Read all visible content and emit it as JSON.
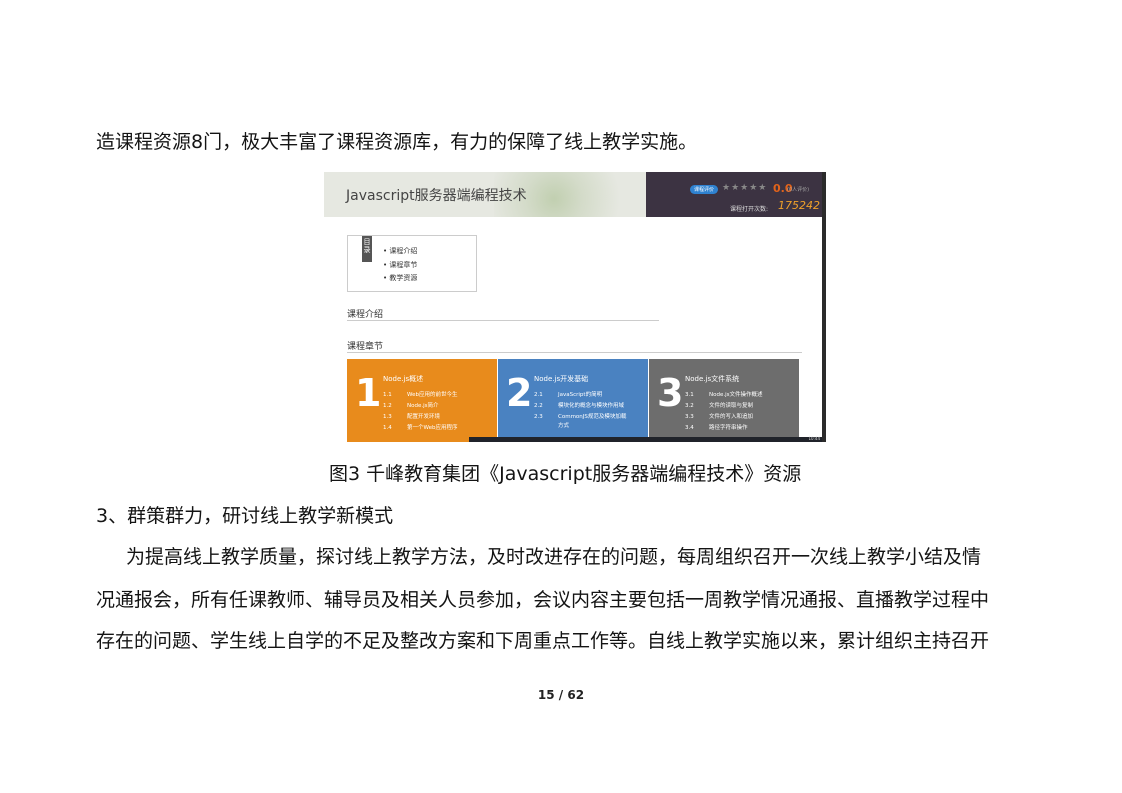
{
  "text": {
    "line1": "造课程资源8门，极大丰富了课程资源库，有力的保障了线上教学实施。",
    "caption": "图3 千峰教育集团《Javascript服务器端编程技术》资源",
    "heading": "3、群策群力，研讨线上教学新模式",
    "para_line1": "为提高线上教学质量，探讨线上教学方法，及时改进存在的问题，每周组织召开一次线上教学小结及情",
    "para_line2": "况通报会，所有任课教师、辅导员及相关人员参加，会议内容主要包括一周教学情况通报、直播教学过程中",
    "para_line3": "存在的问题、学生线上自学的不足及整改方案和下周重点工作等。自线上教学实施以来，累计组织主持召开",
    "page_number": "15 / 62"
  },
  "screenshot": {
    "title": "Javascript服务器端编程技术",
    "rating_badge": "课程评价",
    "stars": "★★★★★",
    "score": "0.0",
    "rating_count_label": "(0人评价)",
    "opens_label": "课程打开次数:",
    "opens_value": "175242",
    "toc_tag": "目录",
    "toc_items": [
      "课程介绍",
      "课程章节",
      "教学资源"
    ],
    "section_intro": "课程介绍",
    "section_chapters": "课程章节",
    "clock": "10:44",
    "chapters": [
      {
        "num": "1",
        "title": "Node.js概述",
        "items": [
          {
            "n": "1.1",
            "t": "Web应用的前世今生"
          },
          {
            "n": "1.2",
            "t": "Node.js简介"
          },
          {
            "n": "1.3",
            "t": "配置开发环境"
          },
          {
            "n": "1.4",
            "t": "第一个Web应用程序"
          }
        ]
      },
      {
        "num": "2",
        "title": "Node.js开发基础",
        "items": [
          {
            "n": "2.1",
            "t": "JavaScript的简明"
          },
          {
            "n": "2.2",
            "t": "模块化的概念与模块作用域"
          },
          {
            "n": "2.3",
            "t": "CommonJS规范及模块加载"
          }
        ],
        "item_cont": "方式"
      },
      {
        "num": "3",
        "title": "Node.js文件系统",
        "items": [
          {
            "n": "3.1",
            "t": "Node.js文件操作概述"
          },
          {
            "n": "3.2",
            "t": "文件的读取与复制"
          },
          {
            "n": "3.3",
            "t": "文件的写入和追加"
          },
          {
            "n": "3.4",
            "t": "路径字符串操作"
          }
        ]
      }
    ]
  },
  "colors": {
    "card1": "#e88b1c",
    "card2": "#4a82c1",
    "card3": "#6d6d6d",
    "header_dark": "#3c3342",
    "highlight_orange": "#f0a12a"
  }
}
